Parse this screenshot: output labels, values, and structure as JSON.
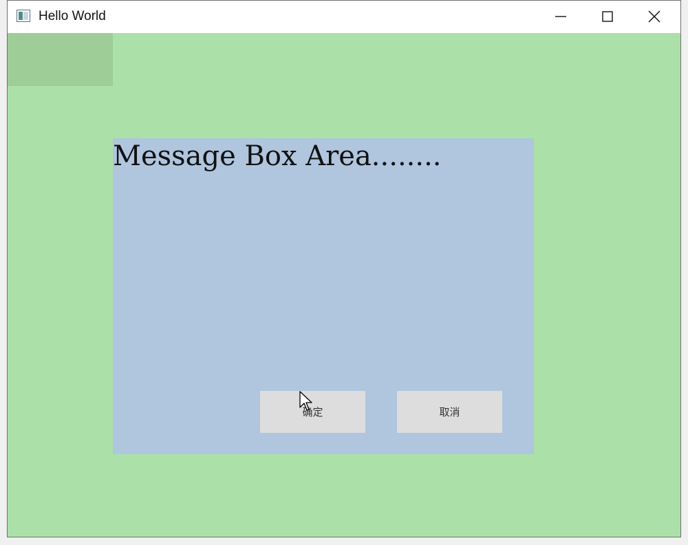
{
  "window": {
    "title": "Hello World",
    "colors": {
      "client_background": "#abe1a9",
      "corner_block": "#9ecd97",
      "message_area": "#b0c5de",
      "button_background": "#dddddd"
    }
  },
  "titlebar": {
    "app_icon": "window-app-icon",
    "minimize_icon": "minimize-icon",
    "maximize_icon": "maximize-icon",
    "close_icon": "close-icon"
  },
  "message_box": {
    "text": "Message Box Area........",
    "ok_label": "确定",
    "cancel_label": "取消"
  }
}
